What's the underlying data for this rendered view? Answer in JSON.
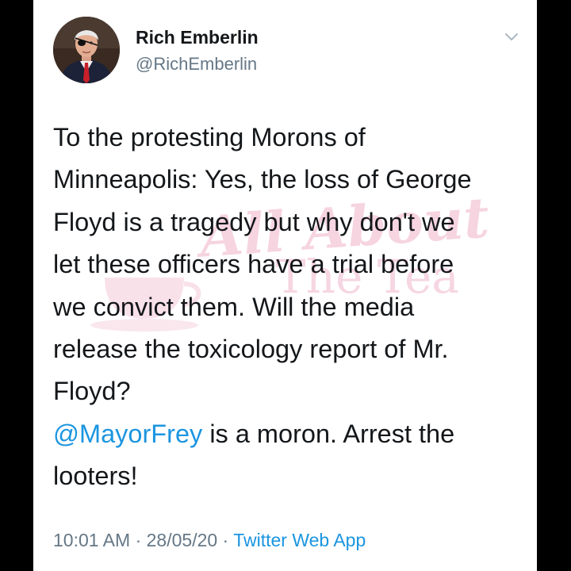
{
  "tweet": {
    "display_name": "Rich Emberlin",
    "handle": "@RichEmberlin",
    "body_lines": [
      "To the protesting Morons of",
      "Minneapolis: Yes, the loss of George",
      "Floyd is a tragedy but why don't we",
      "let these officers have a trial before",
      "we convict them. Will the media",
      "release the toxicology report of Mr.",
      "Floyd?"
    ],
    "mention": "@MayorFrey",
    "mention_rest": " is a moron. Arrest the",
    "last_line": "looters!",
    "time": "10:01 AM",
    "separator": " · ",
    "date": "28/05/20",
    "source": "Twitter Web App"
  },
  "watermark": {
    "line1": "All About",
    "line2": "The Tea"
  },
  "icons": {
    "avatar": "profile-photo",
    "menu": "chevron-down-icon"
  },
  "colors": {
    "text": "#14171a",
    "secondary": "#657786",
    "link": "#1b95e0",
    "watermark": "#e278a0"
  }
}
